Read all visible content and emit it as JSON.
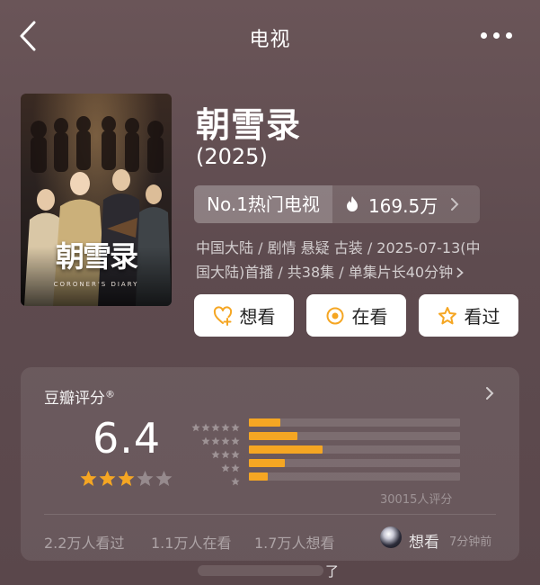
{
  "header": {
    "title": "电视"
  },
  "poster": {
    "logo_text": "朝雪录",
    "english_text": "CORONER'S DIARY"
  },
  "show": {
    "title": "朝雪录",
    "year": "(2025)",
    "rank_label": "No.1热门电视",
    "heat_value": "169.5万",
    "meta_line1": "中国大陆 / 剧情 悬疑 古装 / 2025-07-13(中",
    "meta_line2": "国大陆)首播 / 共38集 / 单集片长40分钟"
  },
  "actions": {
    "want": "想看",
    "watching": "在看",
    "watched": "看过"
  },
  "rating": {
    "label": "豆瓣评分",
    "mark": "®",
    "score": "6.4",
    "star_rating": 3,
    "distribution": [
      {
        "stars": 5,
        "fraction": 0.15
      },
      {
        "stars": 4,
        "fraction": 0.23
      },
      {
        "stars": 3,
        "fraction": 0.35
      },
      {
        "stars": 2,
        "fraction": 0.17
      },
      {
        "stars": 1,
        "fraction": 0.09
      }
    ],
    "count_text": "30015人评分",
    "stat_watched": "2.2万人看过",
    "stat_watching": "1.1万人在看",
    "stat_want": "1.7万人想看",
    "friend_status": "想看",
    "friend_time": "7分钟前"
  },
  "footer": {
    "fragment": "了"
  },
  "colors": {
    "accent": "#f5a623",
    "background": "#5e4b4f"
  }
}
